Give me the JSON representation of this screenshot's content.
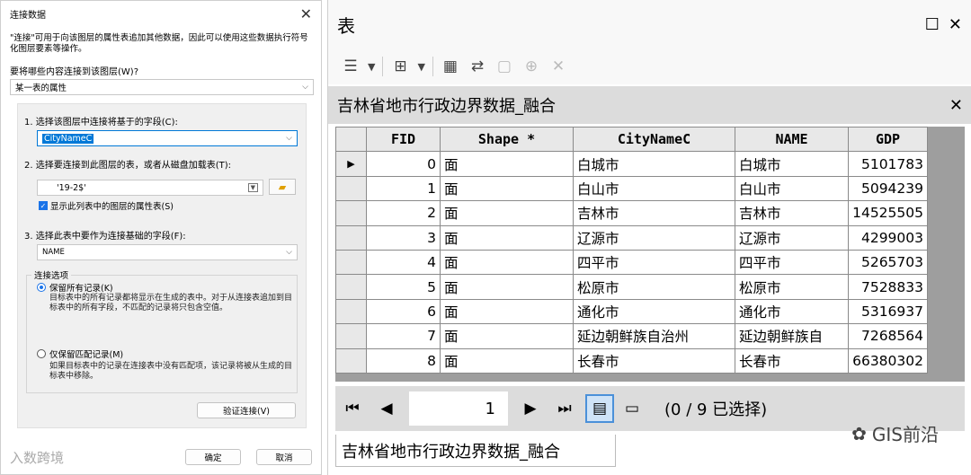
{
  "dialog": {
    "title": "连接数据",
    "close": "✕",
    "description": "\"连接\"可用于向该图层的属性表追加其他数据，因此可以使用这些数据执行符号化图层要素等操作。",
    "question": "要将哪些内容连接到该图层(W)?",
    "join_type": "某一表的属性",
    "step1_label": "1. 选择该图层中连接将基于的字段(C):",
    "step1_value": "CityNameC",
    "step2_label": "2. 选择要连接到此图层的表，或者从磁盘加载表(T):",
    "step2_value": "'19-2$'",
    "show_layers_label": "显示此列表中的图层的属性表(S)",
    "step3_label": "3. 选择此表中要作为连接基础的字段(F):",
    "step3_value": "NAME",
    "options_title": "连接选项",
    "opt_keep_all": "保留所有记录(K)",
    "opt_keep_all_desc": "目标表中的所有记录都将显示在生成的表中。对于从连接表追加到目标表中的所有字段，不匹配的记录将只包含空值。",
    "opt_keep_match": "仅保留匹配记录(M)",
    "opt_keep_match_desc": "如果目标表中的记录在连接表中没有匹配项，该记录将被从生成的目标表中移除。",
    "validate_button": "验证连接(V)",
    "ok_button": "确定",
    "cancel_button": "取消",
    "watermark": "入数跨境"
  },
  "table_window": {
    "title": "表",
    "restore": "☐",
    "close": "✕",
    "layer_name": "吉林省地市行政边界数据_融合",
    "layer_close": "✕",
    "columns": [
      "FID",
      "Shape *",
      "CityNameC",
      "NAME",
      "GDP"
    ],
    "rows": [
      [
        "0",
        "面",
        "白城市",
        "白城市",
        "5101783"
      ],
      [
        "1",
        "面",
        "白山市",
        "白山市",
        "5094239"
      ],
      [
        "2",
        "面",
        "吉林市",
        "吉林市",
        "14525505"
      ],
      [
        "3",
        "面",
        "辽源市",
        "辽源市",
        "4299003"
      ],
      [
        "4",
        "面",
        "四平市",
        "四平市",
        "5265703"
      ],
      [
        "5",
        "面",
        "松原市",
        "松原市",
        "7528833"
      ],
      [
        "6",
        "面",
        "通化市",
        "通化市",
        "5316937"
      ],
      [
        "7",
        "面",
        "延边朝鲜族自治州",
        "延边朝鲜族自",
        "7268564"
      ],
      [
        "8",
        "面",
        "长春市",
        "长春市",
        "66380302"
      ]
    ],
    "current_record": "1",
    "selection_status": "(0 / 9 已选择)",
    "tab_label": "吉林省地市行政边界数据_融合",
    "watermark": "GIS前沿"
  }
}
